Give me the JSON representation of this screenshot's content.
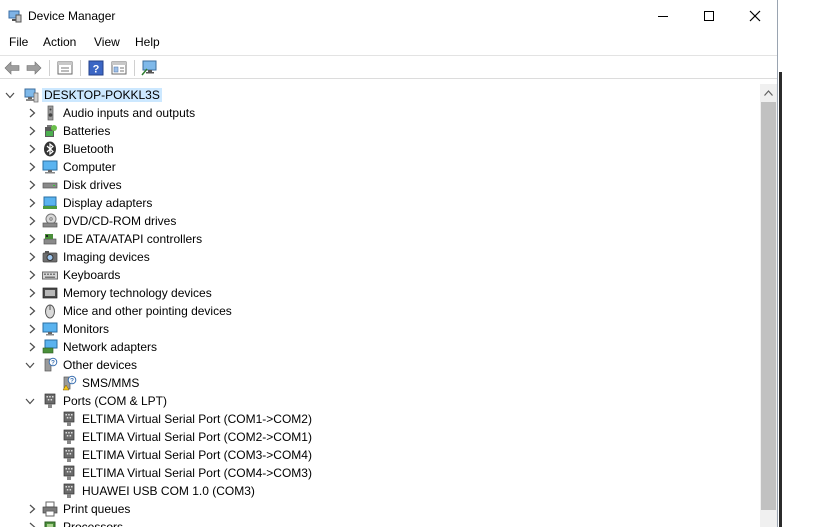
{
  "window": {
    "title": "Device Manager"
  },
  "menu": [
    "File",
    "Action",
    "View",
    "Help"
  ],
  "toolbar": {
    "buttons": [
      "back-arrow-icon",
      "forward-arrow-icon",
      "properties-icon",
      "help-icon",
      "show-hidden-icon",
      "scan-hardware-icon"
    ]
  },
  "tree": {
    "root": "DESKTOP-POKKL3S",
    "categories": [
      {
        "label": "Audio inputs and outputs",
        "icon": "speaker-icon",
        "expanded": false
      },
      {
        "label": "Batteries",
        "icon": "battery-icon",
        "expanded": false
      },
      {
        "label": "Bluetooth",
        "icon": "bluetooth-icon",
        "expanded": false
      },
      {
        "label": "Computer",
        "icon": "computer-icon",
        "expanded": false
      },
      {
        "label": "Disk drives",
        "icon": "disk-drive-icon",
        "expanded": false
      },
      {
        "label": "Display adapters",
        "icon": "display-adapter-icon",
        "expanded": false
      },
      {
        "label": "DVD/CD-ROM drives",
        "icon": "dvd-drive-icon",
        "expanded": false
      },
      {
        "label": "IDE ATA/ATAPI controllers",
        "icon": "ide-controller-icon",
        "expanded": false
      },
      {
        "label": "Imaging devices",
        "icon": "camera-icon",
        "expanded": false
      },
      {
        "label": "Keyboards",
        "icon": "keyboard-icon",
        "expanded": false
      },
      {
        "label": "Memory technology devices",
        "icon": "memory-icon",
        "expanded": false
      },
      {
        "label": "Mice and other pointing devices",
        "icon": "mouse-icon",
        "expanded": false
      },
      {
        "label": "Monitors",
        "icon": "monitor-icon",
        "expanded": false
      },
      {
        "label": "Network adapters",
        "icon": "network-adapter-icon",
        "expanded": false
      },
      {
        "label": "Other devices",
        "icon": "unknown-device-icon",
        "expanded": true,
        "children": [
          {
            "label": "SMS/MMS",
            "icon": "unknown-device-warning-icon"
          }
        ]
      },
      {
        "label": "Ports (COM & LPT)",
        "icon": "port-icon",
        "expanded": true,
        "children": [
          {
            "label": "ELTIMA Virtual Serial Port (COM1->COM2)",
            "icon": "serial-port-icon"
          },
          {
            "label": "ELTIMA Virtual Serial Port (COM2->COM1)",
            "icon": "serial-port-icon"
          },
          {
            "label": "ELTIMA Virtual Serial Port (COM3->COM4)",
            "icon": "serial-port-icon"
          },
          {
            "label": "ELTIMA Virtual Serial Port (COM4->COM3)",
            "icon": "serial-port-icon"
          },
          {
            "label": "HUAWEI USB COM 1.0 (COM3)",
            "icon": "serial-port-icon"
          }
        ]
      },
      {
        "label": "Print queues",
        "icon": "printer-icon",
        "expanded": false
      },
      {
        "label": "Processors",
        "icon": "processor-icon",
        "expanded": false
      }
    ]
  }
}
